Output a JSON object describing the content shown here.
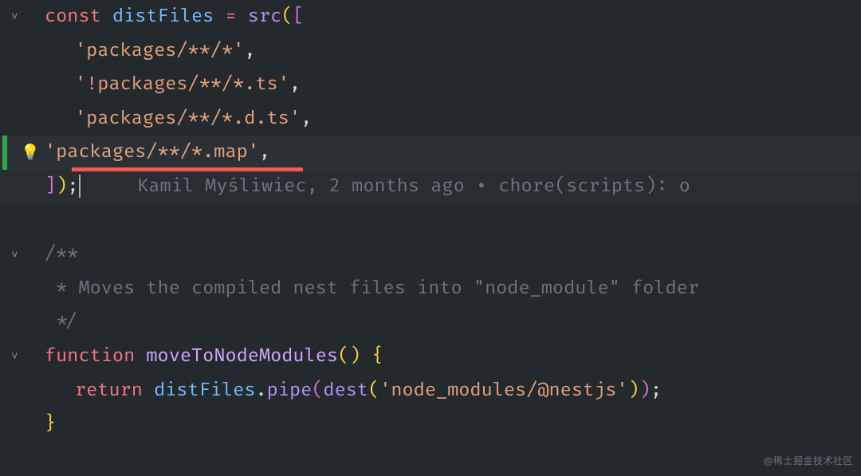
{
  "code": {
    "const_kw": "const",
    "var_name": "distFiles",
    "assign": " = ",
    "src_fn": "src",
    "open_paren": "(",
    "open_bracket": "[",
    "glob1": "'packages/**/*'",
    "comma": ",",
    "glob2": "'!packages/**/*.ts'",
    "glob3": "'packages/**/*.d.ts'",
    "glob4": "'packages/**/*.map'",
    "close_bracket": "]",
    "close_paren": ")",
    "semi": ";",
    "doc1": "/**",
    "doc2": " * Moves the compiled nest files into \"node_module\" folder",
    "doc3": " */",
    "fn_kw": "function",
    "fn_name": "moveToNodeModules",
    "fn_parens": "()",
    "brace_open": " {",
    "return_kw": "return",
    "pipe_var": "distFiles",
    "dot": ".",
    "pipe_fn": "pipe",
    "dest_fn": "dest",
    "dest_arg": "'node_modules/@nestjs'",
    "brace_close": "}"
  },
  "gitlens": {
    "author": "Kamil Myśliwiec",
    "when": "2 months ago",
    "sep": " • ",
    "msg": "chore(scripts): o"
  },
  "watermark": "@稀土掘金技术社区"
}
